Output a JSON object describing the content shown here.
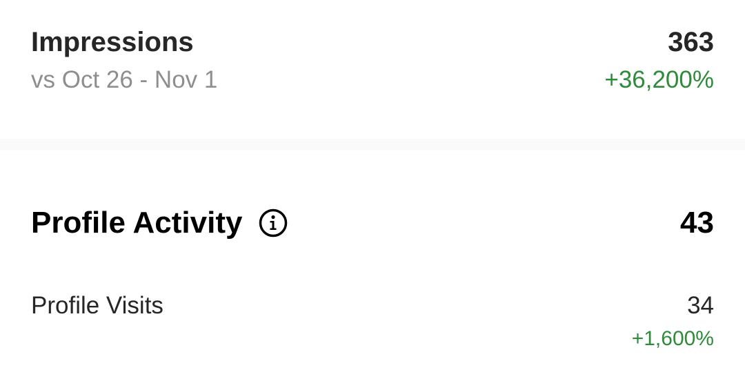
{
  "impressions": {
    "title": "Impressions",
    "comparison_period": "vs Oct 26 - Nov 1",
    "value": "363",
    "change": "+36,200%"
  },
  "profile_activity": {
    "title": "Profile Activity",
    "info_icon": "info-circle-icon",
    "value": "43",
    "visits": {
      "label": "Profile Visits",
      "value": "34",
      "change": "+1,600%"
    }
  },
  "colors": {
    "positive_change": "#2e8b3a",
    "muted_text": "#8e8e8e",
    "primary_text": "#262626",
    "divider": "#fafafa"
  }
}
